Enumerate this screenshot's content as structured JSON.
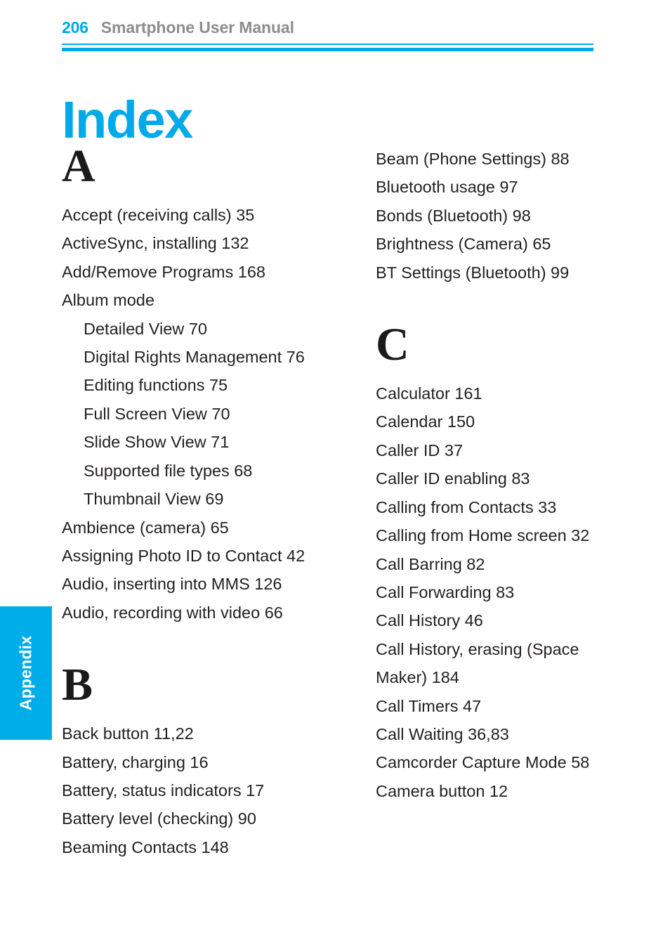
{
  "header": {
    "folio": "206",
    "title": "Smartphone User Manual"
  },
  "chapter": {
    "title": "Index"
  },
  "side_tab": {
    "label": "Appendix",
    "color": "#00ade9"
  },
  "colors": {
    "accent": "#00a9e8",
    "header_title": "#8d8d8d",
    "body_text": "#231f20"
  },
  "index": {
    "left_column": {
      "sections": [
        {
          "letter": "A",
          "entries": [
            {
              "text": "Accept (receiving calls)  35",
              "level": 0
            },
            {
              "text": "ActiveSync, installing  132",
              "level": 0
            },
            {
              "text": "Add/Remove Programs  168",
              "level": 0
            },
            {
              "text": "Album mode",
              "level": 0
            },
            {
              "text": "Detailed View  70",
              "level": 1
            },
            {
              "text": "Digital Rights Management  76",
              "level": 1
            },
            {
              "text": "Editing functions  75",
              "level": 1
            },
            {
              "text": "Full Screen View  70",
              "level": 1
            },
            {
              "text": "Slide Show View  71",
              "level": 1
            },
            {
              "text": "Supported file types  68",
              "level": 1
            },
            {
              "text": "Thumbnail View  69",
              "level": 1
            },
            {
              "text": "Ambience (camera)  65",
              "level": 0
            },
            {
              "text": "Assigning Photo ID to Contact  42",
              "level": 0
            },
            {
              "text": "Audio, inserting into MMS  126",
              "level": 0
            },
            {
              "text": "Audio, recording with video  66",
              "level": 0
            }
          ]
        },
        {
          "letter": "B",
          "entries": [
            {
              "text": "Back button  11,22",
              "level": 0
            },
            {
              "text": "Battery, charging  16",
              "level": 0
            },
            {
              "text": "Battery, status indicators  17",
              "level": 0
            },
            {
              "text": "Battery level (checking)  90",
              "level": 0
            },
            {
              "text": "Beaming Contacts  148",
              "level": 0
            }
          ]
        }
      ]
    },
    "right_column": {
      "sections": [
        {
          "letter": "",
          "entries": [
            {
              "text": "Beam (Phone Settings)  88",
              "level": 0
            },
            {
              "text": "Bluetooth usage  97",
              "level": 0
            },
            {
              "text": "Bonds (Bluetooth)  98",
              "level": 0
            },
            {
              "text": "Brightness (Camera)  65",
              "level": 0
            },
            {
              "text": "BT Settings (Bluetooth)  99",
              "level": 0
            }
          ]
        },
        {
          "letter": "C",
          "entries": [
            {
              "text": "Calculator  161",
              "level": 0
            },
            {
              "text": "Calendar  150",
              "level": 0
            },
            {
              "text": "Caller ID  37",
              "level": 0
            },
            {
              "text": "Caller ID enabling  83",
              "level": 0
            },
            {
              "text": "Calling from Contacts  33",
              "level": 0
            },
            {
              "text": "Calling from Home screen  32",
              "level": 0
            },
            {
              "text": "Call Barring  82",
              "level": 0
            },
            {
              "text": "Call Forwarding  83",
              "level": 0
            },
            {
              "text": "Call History  46",
              "level": 0
            },
            {
              "text": "Call History, erasing (Space Maker)  184",
              "level": 0,
              "wrap": true
            },
            {
              "text": "Call Timers  47",
              "level": 0
            },
            {
              "text": "Call Waiting  36,83",
              "level": 0
            },
            {
              "text": "Camcorder Capture Mode 58",
              "level": 0
            },
            {
              "text": "Camera button  12",
              "level": 0
            }
          ]
        }
      ]
    }
  }
}
